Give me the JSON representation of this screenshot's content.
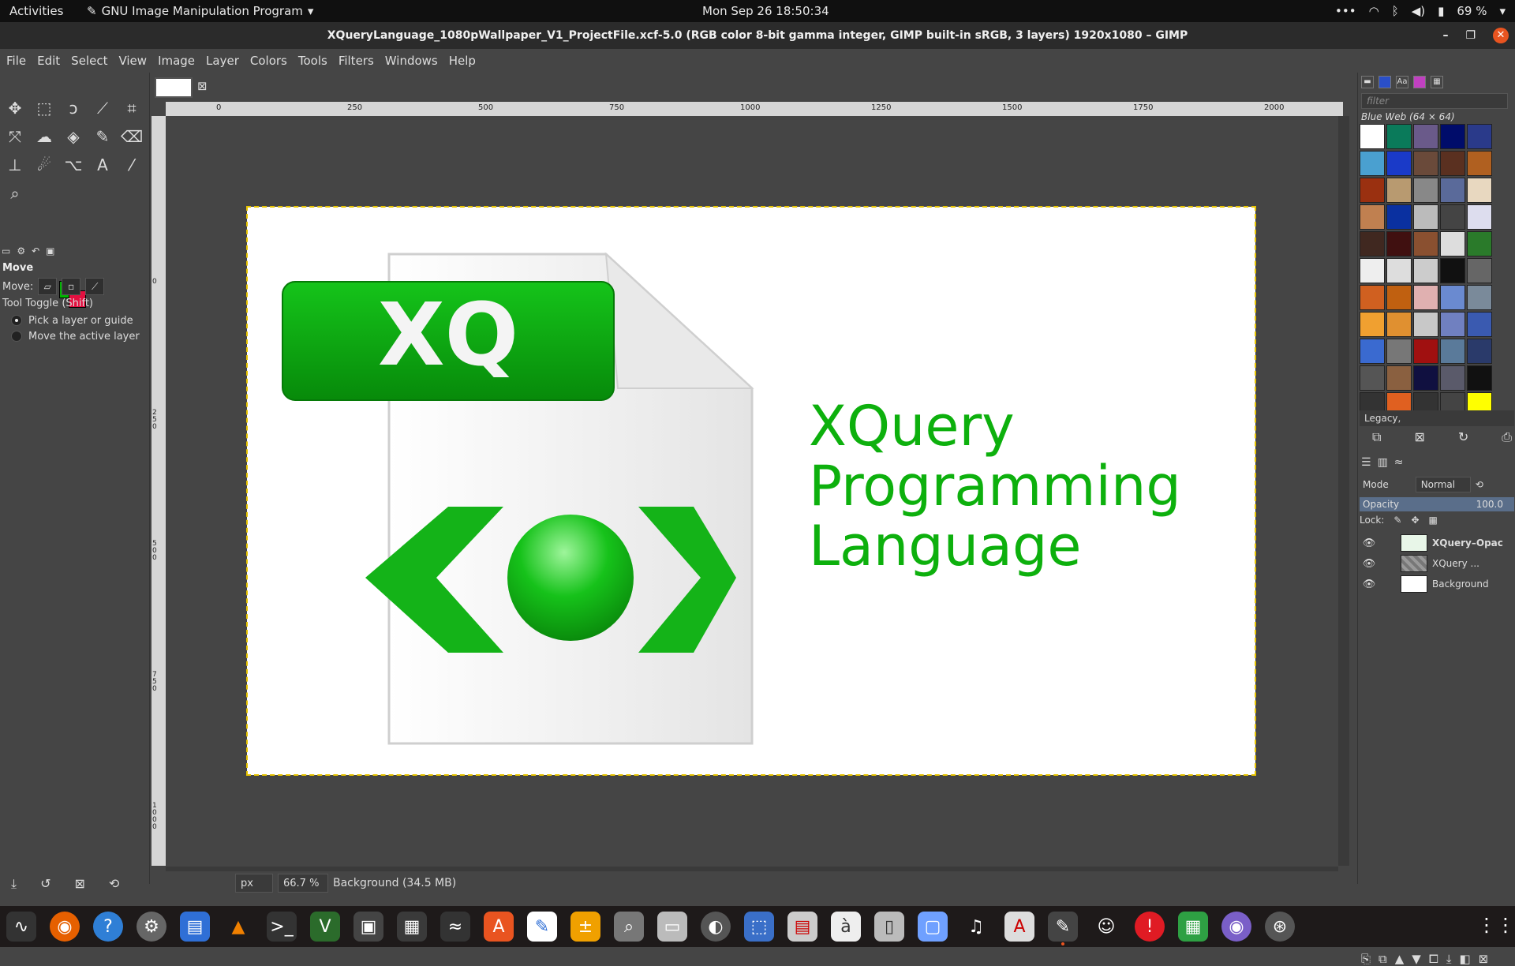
{
  "topbar": {
    "activities": "Activities",
    "app_name": "GNU Image Manipulation Program",
    "clock": "Mon Sep 26  18:50:34",
    "battery": "69 %"
  },
  "window": {
    "title": "XQueryLanguage_1080pWallpaper_V1_ProjectFile.xcf-5.0 (RGB color 8-bit gamma integer, GIMP built-in sRGB, 3 layers) 1920x1080 – GIMP"
  },
  "menu": [
    "File",
    "Edit",
    "Select",
    "View",
    "Image",
    "Layer",
    "Colors",
    "Tools",
    "Filters",
    "Windows",
    "Help"
  ],
  "tool_options": {
    "title": "Move",
    "move_label": "Move:",
    "toggle_label": "Tool Toggle  (Shift)",
    "option1": "Pick a layer or guide",
    "option2": "Move the active layer"
  },
  "ruler_h": [
    "0",
    "250",
    "500",
    "750",
    "1000",
    "1250",
    "1500",
    "1750",
    "2000"
  ],
  "ruler_v": [
    "0",
    "250",
    "500",
    "750",
    "1000"
  ],
  "artwork": {
    "badge": "XQ",
    "line1": "XQuery",
    "line2": "Programming",
    "line3": "Language",
    "text_color": "#0db00d"
  },
  "statusbar": {
    "unit": "px",
    "zoom": "66.7 %",
    "info": "Background (34.5 MB)"
  },
  "colors": {
    "foreground": "#00b400",
    "background": "#e31040"
  },
  "patterns": {
    "filter_placeholder": "filter",
    "selected": "Blue Web (64 × 64)",
    "tag": "Legacy,"
  },
  "layers_panel": {
    "mode_label": "Mode",
    "mode": "Normal",
    "opacity_label": "Opacity",
    "opacity": "100.0",
    "lock_label": "Lock:",
    "layers": [
      {
        "name": "XQuery–Opac",
        "selected": true
      },
      {
        "name": "XQuery ...",
        "selected": false
      },
      {
        "name": "Background",
        "selected": false
      }
    ]
  }
}
